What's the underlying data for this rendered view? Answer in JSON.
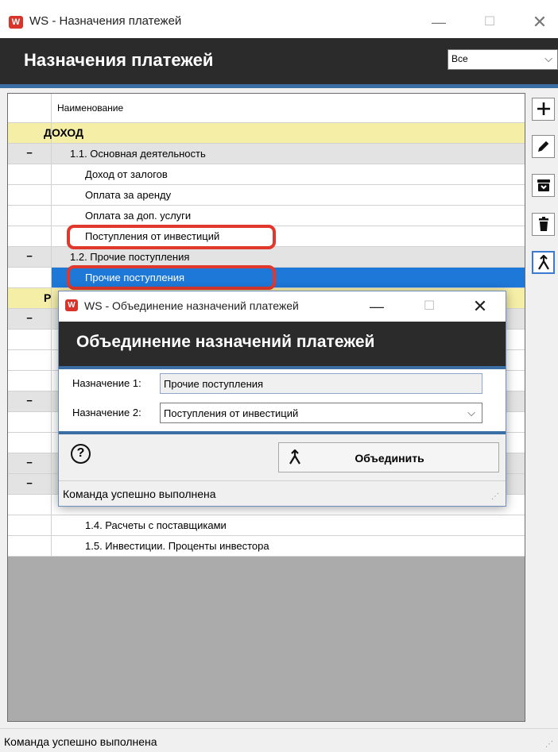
{
  "window": {
    "app_icon_text": "W",
    "title": "WS - Назначения платежей",
    "minimize": "—",
    "maximize": "☐",
    "close": "✕"
  },
  "header": {
    "title": "Назначения платежей",
    "filter": {
      "selected": "Все",
      "chevron": "⌵"
    }
  },
  "grid": {
    "column_header": "Наименование",
    "rows": [
      {
        "marker": "",
        "text": "ДОХОД",
        "type": "group"
      },
      {
        "marker": "−",
        "text": "1.1. Основная деятельность",
        "type": "sub"
      },
      {
        "marker": "",
        "text": "Доход от залогов",
        "type": "item"
      },
      {
        "marker": "",
        "text": "Оплата за аренду",
        "type": "item"
      },
      {
        "marker": "",
        "text": "Оплата за доп. услуги",
        "type": "item"
      },
      {
        "marker": "",
        "text": "Поступления от инвестиций",
        "type": "item",
        "highlighted": true
      },
      {
        "marker": "−",
        "text": "1.2. Прочие поступления",
        "type": "sub"
      },
      {
        "marker": "",
        "text": "Прочие поступления",
        "type": "item",
        "selected": true,
        "highlighted": true
      },
      {
        "marker": "",
        "text": "Р",
        "type": "group"
      },
      {
        "marker": "−",
        "text": "",
        "type": "sub"
      },
      {
        "marker": "",
        "text": "",
        "type": "item"
      },
      {
        "marker": "",
        "text": "",
        "type": "item"
      },
      {
        "marker": "",
        "text": "",
        "type": "item"
      },
      {
        "marker": "−",
        "text": "",
        "type": "sub"
      },
      {
        "marker": "",
        "text": "",
        "type": "item"
      },
      {
        "marker": "",
        "text": "",
        "type": "item"
      },
      {
        "marker": "−",
        "text": "",
        "type": "sub"
      },
      {
        "marker": "−",
        "text": "",
        "type": "sub"
      },
      {
        "marker": "",
        "text": "",
        "type": "item"
      },
      {
        "marker": "",
        "text": "1.4. Расчеты с поставщиками",
        "type": "item"
      },
      {
        "marker": "",
        "text": "1.5. Инвестиции. Проценты инвестора",
        "type": "item"
      }
    ],
    "highlight_color": "#e0382c",
    "selection_color": "#1e78d7"
  },
  "toolbar": [
    {
      "icon": "plus-icon"
    },
    {
      "icon": "pencil-icon"
    },
    {
      "icon": "archive-icon"
    },
    {
      "icon": "trash-icon"
    },
    {
      "icon": "merge-icon"
    }
  ],
  "status": {
    "text": "Команда успешно выполнена"
  },
  "dialog": {
    "title": "WS - Объединение назначений платежей",
    "header": "Объединение назначений платежей",
    "field1": {
      "label": "Назначение 1:",
      "value": "Прочие поступления"
    },
    "field2": {
      "label": "Назначение 2:",
      "value": "Поступления от инвестиций",
      "chevron": "⌵"
    },
    "help": "?",
    "merge_button": "Объединить",
    "status": "Команда успешно выполнена"
  },
  "colors": {
    "dark_header": "#2b2b2b",
    "accent": "#3b6ea5",
    "group_row": "#f5eea6",
    "sub_row": "#e3e3e3"
  }
}
